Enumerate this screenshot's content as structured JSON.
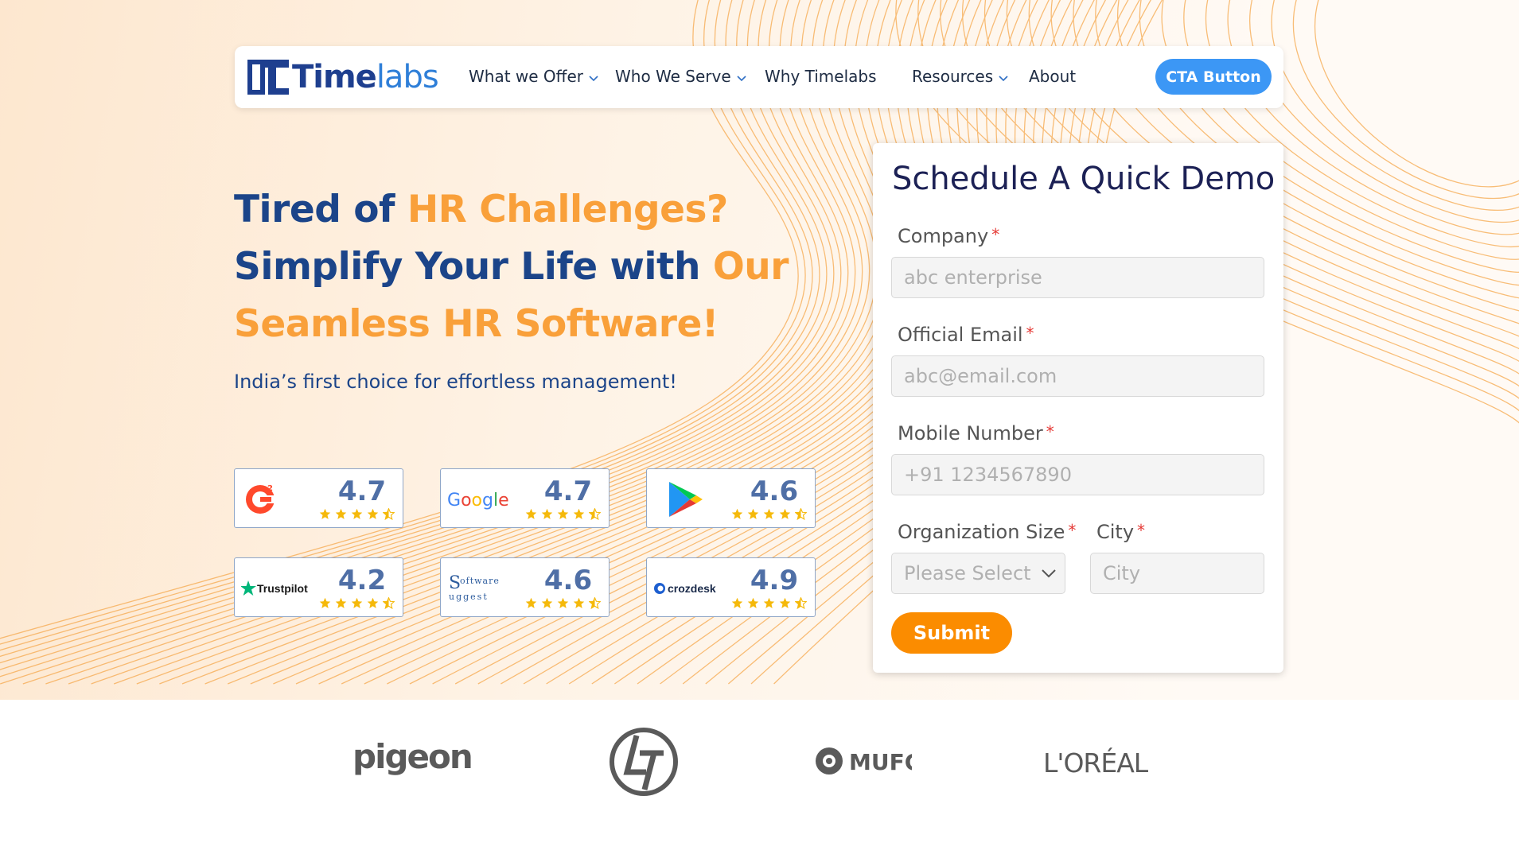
{
  "brand": {
    "name_part1": "Time",
    "name_part2": "labs"
  },
  "nav": {
    "items": [
      {
        "label": "What we Offer",
        "has_dropdown": true
      },
      {
        "label": "Who We Serve",
        "has_dropdown": true
      },
      {
        "label": "Why Timelabs",
        "has_dropdown": false
      },
      {
        "label": "Resources",
        "has_dropdown": true
      },
      {
        "label": "About",
        "has_dropdown": false
      }
    ],
    "cta_label": "CTA Button"
  },
  "hero": {
    "line1_a": "Tired of ",
    "line1_b": "HR Challenges?",
    "line2_a": "Simplify Your Life with ",
    "line2_b": "Our",
    "line3": "Seamless HR Software!",
    "subtitle": "India’s first choice for effortless management!"
  },
  "ratings": [
    {
      "platform": "G2",
      "icon": "g2-logo",
      "rating": "4.7"
    },
    {
      "platform": "Google",
      "icon": "google-logo",
      "rating": "4.7"
    },
    {
      "platform": "Google Play",
      "icon": "google-play-logo",
      "rating": "4.6"
    },
    {
      "platform": "Trustpilot",
      "icon": "trustpilot-logo",
      "rating": "4.2"
    },
    {
      "platform": "Software Suggest",
      "icon": "software-suggest-logo",
      "rating": "4.6"
    },
    {
      "platform": "crozdesk",
      "icon": "crozdesk-logo",
      "rating": "4.9"
    }
  ],
  "form": {
    "title": "Schedule A Quick Demo",
    "company_label": "Company",
    "company_placeholder": "abc enterprise",
    "email_label": "Official Email",
    "email_placeholder": "abc@email.com",
    "mobile_label": "Mobile Number",
    "mobile_placeholder": "+91 1234567890",
    "org_size_label": "Organization Size",
    "org_size_value": "Please Select",
    "city_label": "City",
    "city_placeholder": "City",
    "required_mark": "*",
    "submit_label": "Submit"
  },
  "clients": [
    "pigeon",
    "L&T",
    "MUFG",
    "L'ORÉAL"
  ],
  "colors": {
    "navy": "#1b4489",
    "orange": "#f9a03a",
    "cta_blue": "#3c97f5",
    "submit_orange": "#fb8c00",
    "star": "#f5b90a"
  }
}
